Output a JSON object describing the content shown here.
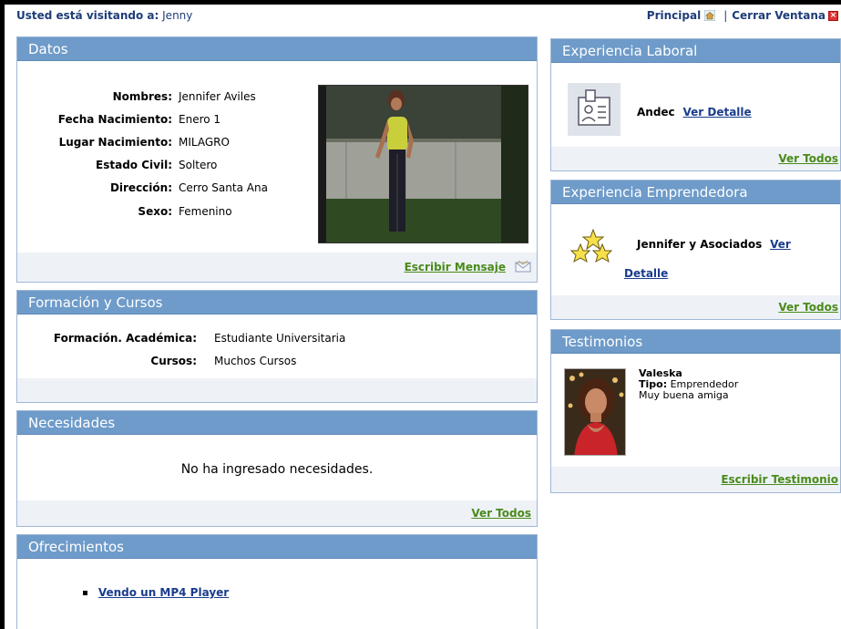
{
  "topbar": {
    "visiting_label": "Usted está visitando a:",
    "visiting_name": "Jenny",
    "principal_label": "Principal",
    "separator": "|",
    "close_label": "Cerrar Ventana",
    "close_glyph": "×"
  },
  "datos": {
    "title": "Datos",
    "fields": [
      {
        "label": "Nombres:",
        "value": "Jennifer Aviles"
      },
      {
        "label": "Fecha Nacimiento:",
        "value": "Enero 1"
      },
      {
        "label": "Lugar Nacimiento:",
        "value": "MILAGRO"
      },
      {
        "label": "Estado Civil:",
        "value": "Soltero"
      },
      {
        "label": "Dirección:",
        "value": "Cerro Santa Ana"
      },
      {
        "label": "Sexo:",
        "value": "Femenino"
      }
    ],
    "message_link": "Escribir Mensaje"
  },
  "formacion": {
    "title": "Formación y Cursos",
    "academica_label": "Formación. Académica:",
    "academica_value": "Estudiante Universitaria",
    "cursos_label": "Cursos:",
    "cursos_value": "Muchos Cursos"
  },
  "necesidades": {
    "title": "Necesidades",
    "empty_text": "No ha ingresado necesidades.",
    "view_all": "Ver Todos"
  },
  "ofrecimientos": {
    "title": "Ofrecimientos",
    "items": [
      "Vendo un MP4 Player"
    ]
  },
  "experiencia_laboral": {
    "title": "Experiencia Laboral",
    "company": "Andec",
    "detail_link": "Ver Detalle",
    "view_all": "Ver Todos"
  },
  "experiencia_emprendedora": {
    "title": "Experiencia Emprendedora",
    "company": "Jennifer y Asociados",
    "detail_link_1": "Ver",
    "detail_link_2": "Detalle",
    "view_all": "Ver Todos"
  },
  "testimonios": {
    "title": "Testimonios",
    "author": "Valeska",
    "type_label": "Tipo:",
    "type_value": "Emprendedor",
    "comment": "Muy buena amiga",
    "write_link": "Escribir Testimonio"
  },
  "colors": {
    "header_bg": "#6e9bc9",
    "footer_bg": "#eef2f7",
    "link_blue": "#1a3c8c",
    "link_green": "#4a8a1a"
  }
}
